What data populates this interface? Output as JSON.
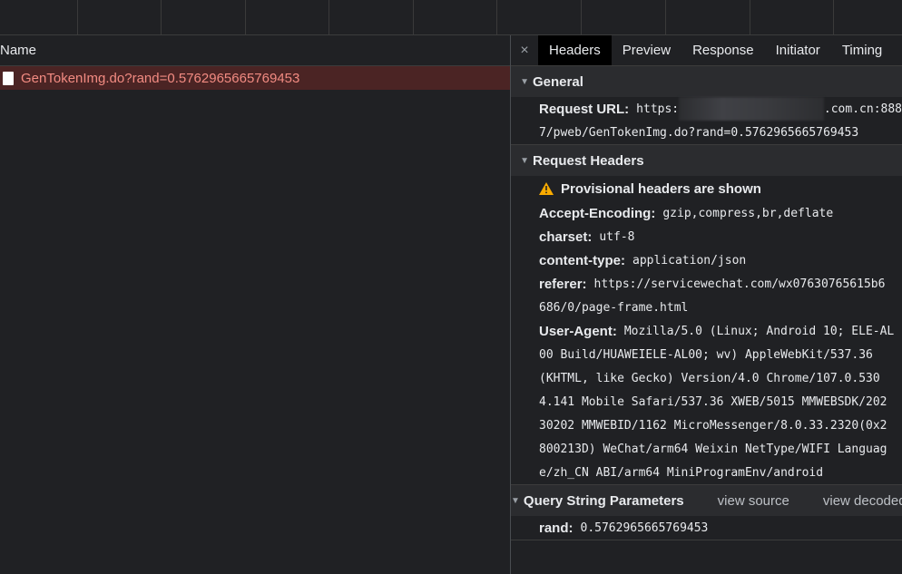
{
  "network": {
    "name_header": "Name",
    "request_name": "GenTokenImg.do?rand=0.5762965665769453"
  },
  "tabs": {
    "close_glyph": "×",
    "items": [
      "Headers",
      "Preview",
      "Response",
      "Initiator",
      "Timing"
    ],
    "active": "Headers"
  },
  "general": {
    "title": "General",
    "request_url_key": "Request URL:",
    "request_url_prefix": "https:",
    "request_url_suffix": ".com.cn:888",
    "request_url_line2": "7/pweb/GenTokenImg.do?rand=0.5762965665769453"
  },
  "request_headers": {
    "title": "Request Headers",
    "warning": "Provisional headers are shown",
    "accept_encoding_key": "Accept-Encoding:",
    "accept_encoding_val": "gzip,compress,br,deflate",
    "charset_key": "charset:",
    "charset_val": "utf-8",
    "content_type_key": "content-type:",
    "content_type_val": "application/json",
    "referer_key": "referer:",
    "referer_line1": "https://servicewechat.com/wx07630765615b6",
    "referer_line2": "686/0/page-frame.html",
    "user_agent_key": "User-Agent:",
    "user_agent_lines": [
      "Mozilla/5.0 (Linux; Android 10; ELE-AL",
      "00 Build/HUAWEIELE-AL00; wv) AppleWebKit/537.36",
      "(KHTML, like Gecko) Version/4.0 Chrome/107.0.530",
      "4.141 Mobile Safari/537.36 XWEB/5015 MMWEBSDK/202",
      "30202 MMWEBID/1162 MicroMessenger/8.0.33.2320(0x2",
      "800213D) WeChat/arm64 Weixin NetType/WIFI Languag",
      "e/zh_CN ABI/arm64 MiniProgramEnv/android"
    ]
  },
  "query": {
    "title": "Query String Parameters",
    "view_source": "view source",
    "view_decoded": "view decoded",
    "rand_key": "rand:",
    "rand_val": "0.5762965665769453"
  },
  "colors": {
    "background": "#202124",
    "selected_row": "#4b2424",
    "error_text": "#f28b82",
    "warning": "#f9ab00"
  }
}
